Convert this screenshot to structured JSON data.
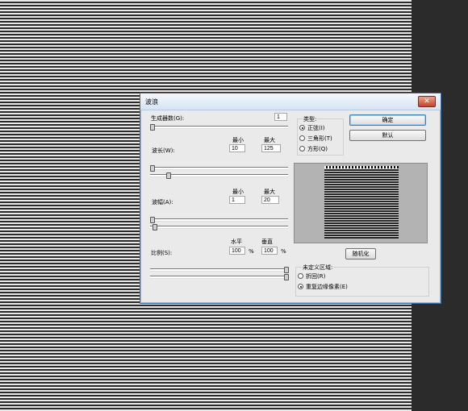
{
  "dialog": {
    "title": "波浪",
    "close_icon": "close-icon",
    "generators": {
      "label": "生成器数(G):",
      "value": "1"
    },
    "wavelength": {
      "label": "波长(W):",
      "min_label": "最小",
      "max_label": "最大",
      "min": "10",
      "max": "125"
    },
    "amplitude": {
      "label": "波幅(A):",
      "min_label": "最小",
      "max_label": "最大",
      "min": "1",
      "max": "20"
    },
    "scale": {
      "label": "比例(S):",
      "h_label": "水平",
      "v_label": "垂直",
      "h": "100",
      "v": "100",
      "unit": "%"
    },
    "type": {
      "label": "类型:",
      "options": [
        "正弦(I)",
        "三角形(T)",
        "方形(Q)"
      ],
      "selected_index": 0
    },
    "buttons": {
      "ok": "确定",
      "reset": "默认",
      "randomize": "随机化"
    },
    "undefined_area": {
      "label": "未定义区域:",
      "options": [
        "折回(R)",
        "重复边缘像素(E)"
      ],
      "selected_index": 1
    },
    "sliders": {
      "generators": 0.0,
      "wavelength_min": 0.0,
      "wavelength_max": 0.12,
      "amplitude_min": 0.0,
      "amplitude_max": 0.02,
      "scale_h": 1.0,
      "scale_v": 1.0
    }
  }
}
